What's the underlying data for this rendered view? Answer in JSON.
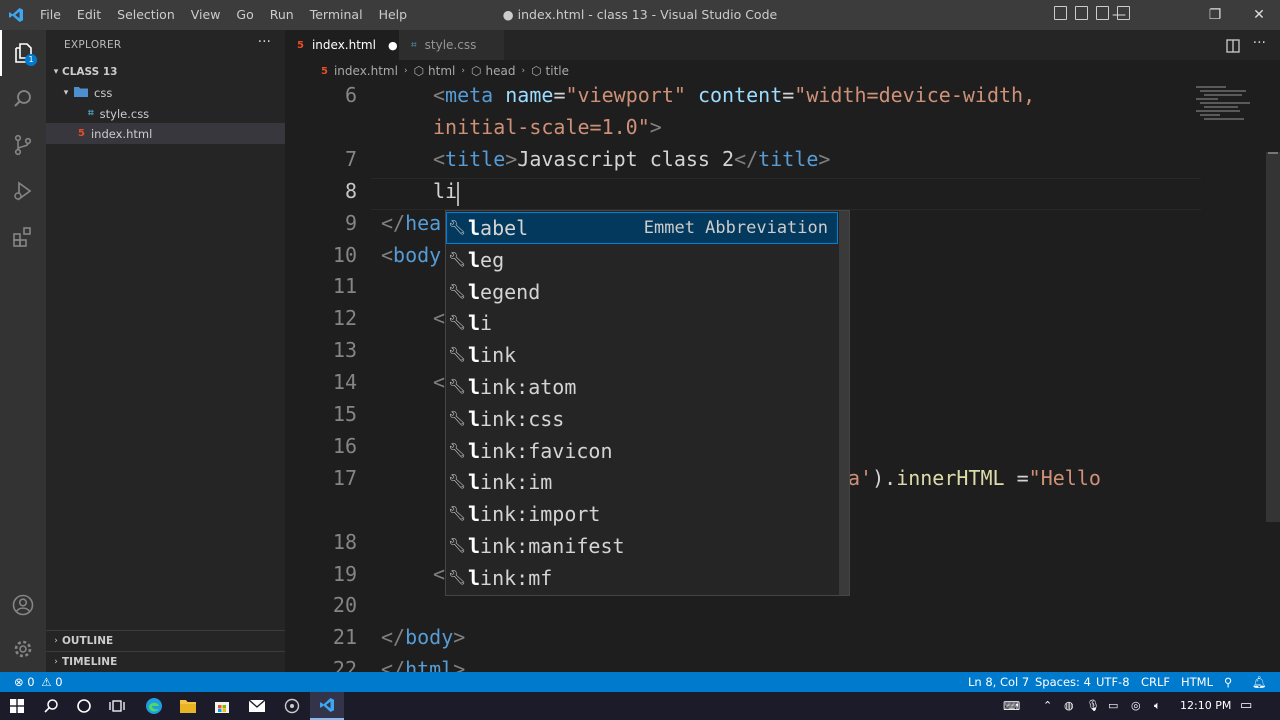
{
  "window": {
    "title": "● index.html - class 13 - Visual Studio Code",
    "menu": [
      "File",
      "Edit",
      "Selection",
      "View",
      "Go",
      "Run",
      "Terminal",
      "Help"
    ]
  },
  "explorer": {
    "title": "EXPLORER",
    "more": "···",
    "workspace": "CLASS 13",
    "folder": "css",
    "files": [
      "style.css",
      "index.html"
    ],
    "outline": "OUTLINE",
    "timeline": "TIMELINE"
  },
  "tabs": [
    {
      "label": "index.html",
      "dirty": "●"
    },
    {
      "label": "style.css"
    }
  ],
  "breadcrumb": [
    "index.html",
    "html",
    "head",
    "title"
  ],
  "editor": {
    "lines": [
      {
        "n": "6",
        "tokens": [
          [
            "tg",
            "<"
          ],
          [
            "tn",
            "meta"
          ],
          [
            "d",
            " "
          ],
          [
            "an",
            "name"
          ],
          [
            "d",
            "="
          ],
          [
            "av",
            "\"viewport\""
          ],
          [
            "d",
            " "
          ],
          [
            "an",
            "content"
          ],
          [
            "d",
            "="
          ],
          [
            "av",
            "\"width=device-width,"
          ]
        ],
        "indent": 52
      },
      {
        "n": "",
        "tokens": [
          [
            "av",
            "initial-scale=1.0\""
          ],
          [
            "tg",
            ">"
          ]
        ],
        "indent": 52
      },
      {
        "n": "7",
        "tokens": [
          [
            "tg",
            "<"
          ],
          [
            "tn",
            "title"
          ],
          [
            "tg",
            ">"
          ],
          [
            "d",
            "Javascript class 2"
          ],
          [
            "tg",
            "</"
          ],
          [
            "tn",
            "title"
          ],
          [
            "tg",
            ">"
          ]
        ],
        "indent": 52
      },
      {
        "n": "8",
        "tokens": [
          [
            "d",
            "li"
          ]
        ],
        "indent": 52
      },
      {
        "n": "9",
        "tokens": [
          [
            "tg",
            "</"
          ],
          [
            "tn",
            "hea"
          ]
        ],
        "indent": 0
      },
      {
        "n": "10",
        "tokens": [
          [
            "tg",
            "<"
          ],
          [
            "tn",
            "body"
          ]
        ],
        "indent": 0
      },
      {
        "n": "11",
        "tokens": [],
        "indent": 0
      },
      {
        "n": "12",
        "tokens": [
          [
            "tg",
            "<"
          ]
        ],
        "indent": 52
      },
      {
        "n": "13",
        "tokens": [],
        "indent": 0
      },
      {
        "n": "14",
        "tokens": [
          [
            "tg",
            "<"
          ]
        ],
        "indent": 52
      },
      {
        "n": "15",
        "tokens": [],
        "indent": 0
      },
      {
        "n": "16",
        "tokens": [],
        "indent": 0
      },
      {
        "n": "17",
        "tokens": [],
        "indent": 0
      },
      {
        "n": "",
        "tokens": [],
        "indent": 0
      },
      {
        "n": "18",
        "tokens": [],
        "indent": 0
      },
      {
        "n": "19",
        "tokens": [
          [
            "tg",
            "<"
          ]
        ],
        "indent": 52
      },
      {
        "n": "20",
        "tokens": [],
        "indent": 0
      },
      {
        "n": "21",
        "tokens": [
          [
            "tg",
            "</"
          ],
          [
            "tn",
            "body"
          ],
          [
            "tg",
            ">"
          ]
        ],
        "indent": 0
      },
      {
        "n": "22",
        "tokens": [
          [
            "tg",
            "</"
          ],
          [
            "tn",
            "html"
          ],
          [
            "tg",
            ">"
          ]
        ],
        "indent": 0
      }
    ],
    "line17_tail": {
      "prefix": "a'",
      "rest": ").",
      "prop": "innerHTML",
      "op": " =",
      "str": "\"Hello"
    }
  },
  "suggest": {
    "typed": "l",
    "detail": "Emmet Abbreviation",
    "items": [
      "label",
      "leg",
      "legend",
      "li",
      "link",
      "link:atom",
      "link:css",
      "link:favicon",
      "link:im",
      "link:import",
      "link:manifest",
      "link:mf"
    ]
  },
  "status": {
    "errors": "0",
    "warnings": "0",
    "position": "Ln 8, Col 7",
    "spaces": "Spaces: 4",
    "encoding": "UTF-8",
    "eol": "CRLF",
    "language": "HTML"
  },
  "taskbar": {
    "time": "12:10 PM"
  },
  "colors": {
    "accent": "#007acc",
    "titlebar": "#3c3c3c",
    "editor_bg": "#1e1e1e",
    "sidebar_bg": "#252526"
  }
}
